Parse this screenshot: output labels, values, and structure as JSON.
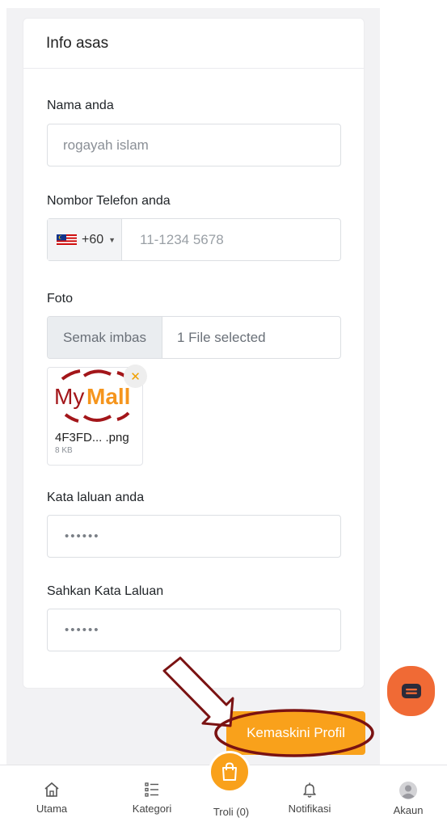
{
  "card": {
    "title": "Info asas"
  },
  "fields": {
    "name": {
      "label": "Nama anda",
      "value": "rogayah islam"
    },
    "phone": {
      "label": "Nombor Telefon anda",
      "country_code": "+60",
      "placeholder": "11-1234 5678"
    },
    "photo": {
      "label": "Foto",
      "browse_label": "Semak imbas",
      "status": "1 File selected",
      "file_name": "4F3FD...  .png",
      "file_size": "8 KB",
      "logo_text_a": "My",
      "logo_text_b": "Mall",
      "remove_icon": "close-icon"
    },
    "password": {
      "label": "Kata laluan anda",
      "value": "••••••"
    },
    "confirm_password": {
      "label": "Sahkan Kata Laluan",
      "value": "••••••"
    }
  },
  "actions": {
    "update_label": "Kemaskini Profil"
  },
  "colors": {
    "accent": "#f9a11b",
    "chat": "#f06a35",
    "annotation": "#7a1212"
  },
  "bottom_nav": [
    {
      "label": "Utama",
      "icon": "home-icon"
    },
    {
      "label": "Kategori",
      "icon": "list-icon"
    },
    {
      "label": "Troli (0)",
      "icon": "shopping-bag-icon"
    },
    {
      "label": "Notifikasi",
      "icon": "bell-icon"
    },
    {
      "label": "Akaun",
      "icon": "avatar-icon"
    }
  ]
}
